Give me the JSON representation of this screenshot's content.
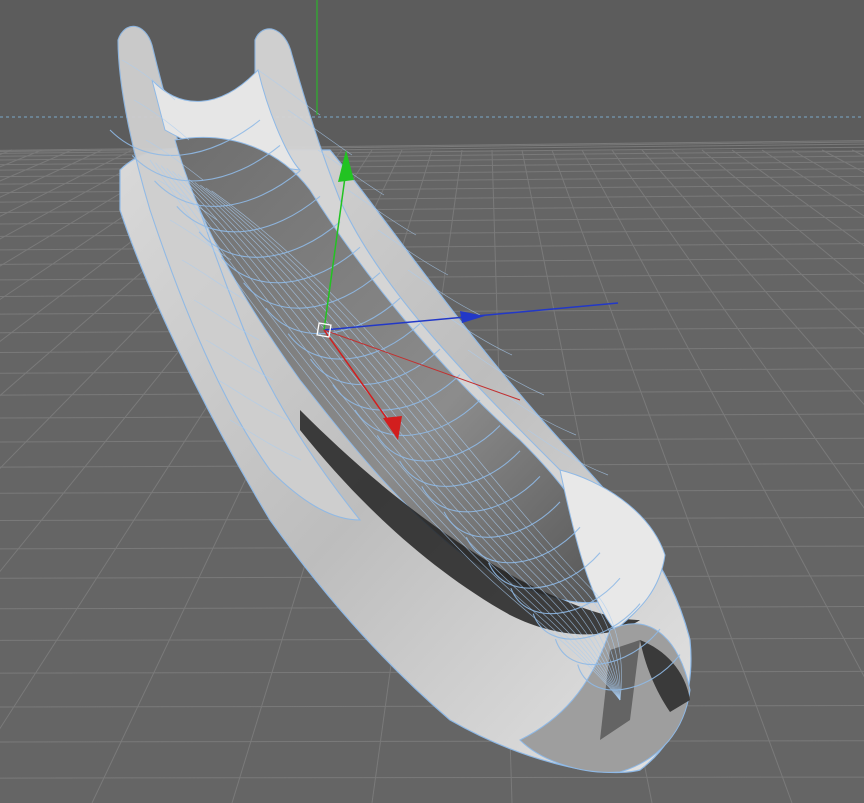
{
  "viewport": {
    "view": "perspective",
    "grid": true,
    "background_color": "#5e5e5e",
    "grid_color": "#7a7a7a",
    "wireframe_color": "#8fb9e6",
    "axis_colors": {
      "x": "#d21e1e",
      "y": "#22c322",
      "z": "#2238c8"
    }
  }
}
